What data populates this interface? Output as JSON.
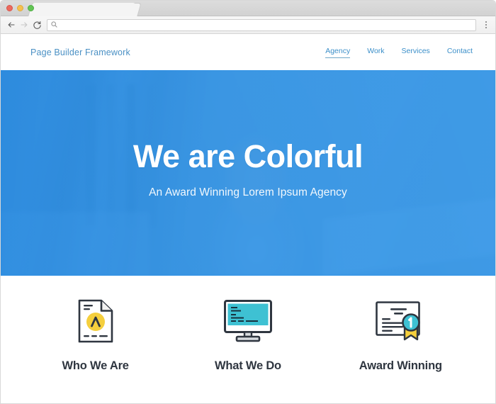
{
  "browser": {
    "traffic_lights": [
      "close",
      "minimize",
      "zoom"
    ],
    "tab_title": "",
    "back_label": "Back",
    "forward_label": "Forward",
    "reload_label": "Reload",
    "address_value": "",
    "address_placeholder": "",
    "menu_label": "Customize and control"
  },
  "site": {
    "brand": "Page Builder Framework",
    "nav": [
      {
        "label": "Agency",
        "active": true
      },
      {
        "label": "Work",
        "active": false
      },
      {
        "label": "Services",
        "active": false
      },
      {
        "label": "Contact",
        "active": false
      }
    ],
    "hero": {
      "title": "We are Colorful",
      "subtitle": "An Award Winning Lorem Ipsum Agency",
      "overlay_color": "#2f93e8"
    },
    "features": [
      {
        "title": "Who We Are",
        "icon": "document-badge-icon"
      },
      {
        "title": "What We Do",
        "icon": "desktop-monitor-icon"
      },
      {
        "title": "Award Winning",
        "icon": "certificate-award-icon"
      }
    ],
    "colors": {
      "hero_blue": "#2f93e8",
      "link_blue": "#3b8fc9",
      "icon_yellow": "#f5cf3d",
      "icon_teal": "#3ec1d3",
      "heading_dark": "#2f3640"
    }
  }
}
